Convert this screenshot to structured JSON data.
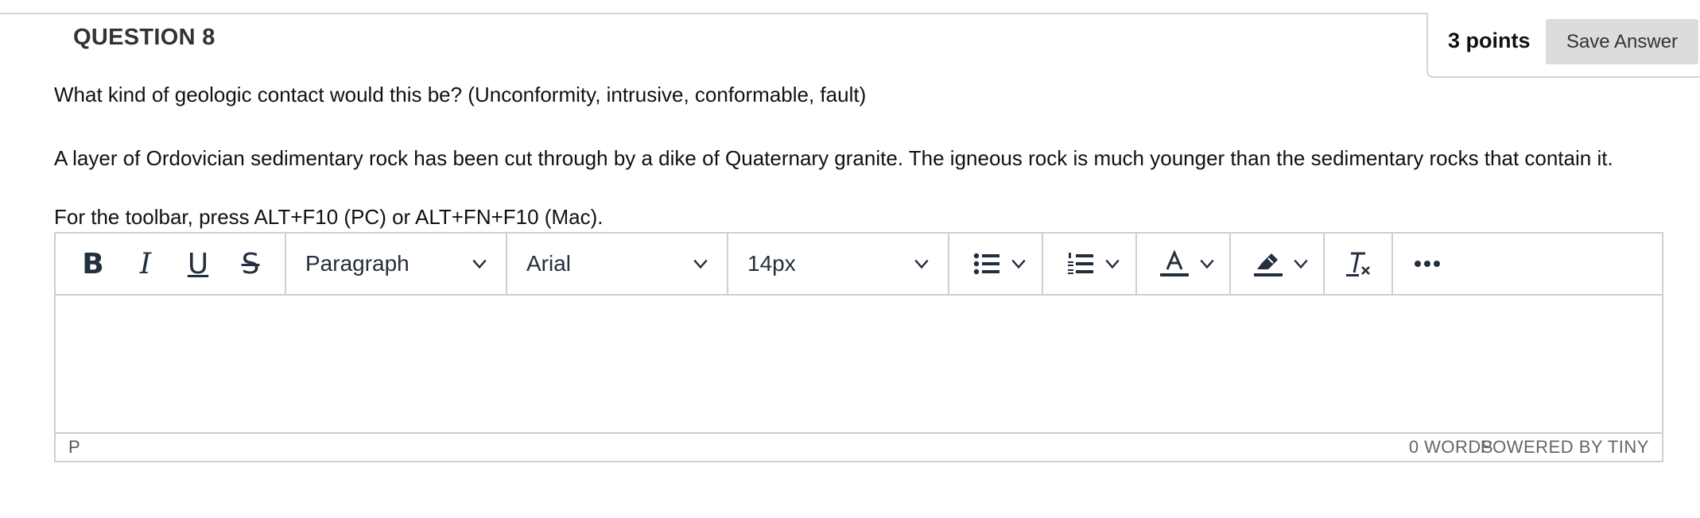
{
  "question": {
    "title": "QUESTION 8",
    "points": "3 points",
    "save_label": "Save Answer",
    "prompt": "What kind of geologic contact would this be? (Unconformity, intrusive, conformable, fault)",
    "scenario": "A layer of Ordovician sedimentary rock has been cut through by a dike of Quaternary granite. The igneous rock is much younger than the sedimentary rocks that contain it.",
    "toolbar_hint": "For the toolbar, press ALT+F10 (PC) or ALT+FN+F10 (Mac)."
  },
  "editor": {
    "toolbar": {
      "bold": "B",
      "italic": "I",
      "underline": "U",
      "strikethrough": "S",
      "block_format": "Paragraph",
      "font_family": "Arial",
      "font_size": "14px",
      "icons": [
        "bullet-list-icon",
        "numbered-list-icon",
        "text-color-icon",
        "highlight-color-icon",
        "clear-formatting-icon",
        "more-icon"
      ]
    },
    "status": {
      "path": "P",
      "word_count": "0 WORDS",
      "branding": "POWERED BY TINY"
    }
  },
  "colors": {
    "icon": "#222f3e",
    "border": "#cfcfcf",
    "save_button_bg": "#dcdcdc"
  }
}
